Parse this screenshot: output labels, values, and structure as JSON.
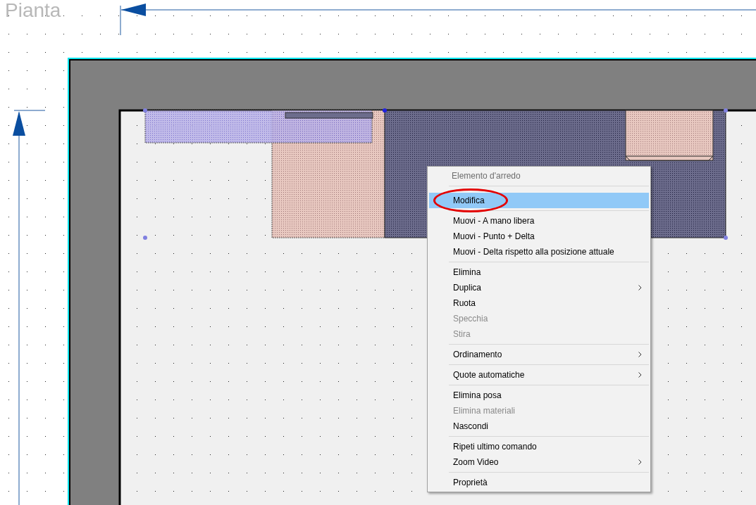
{
  "view": {
    "title": "Pianta"
  },
  "context_menu": {
    "header": "Elemento d'arredo",
    "groups": [
      [
        {
          "label": "Modifica",
          "selected": true,
          "disabled": false,
          "submenu": false,
          "circled": true
        }
      ],
      [
        {
          "label": "Muovi - A mano libera",
          "selected": false,
          "disabled": false,
          "submenu": false,
          "circled": false
        },
        {
          "label": "Muovi - Punto + Delta",
          "selected": false,
          "disabled": false,
          "submenu": false,
          "circled": false
        },
        {
          "label": "Muovi - Delta rispetto alla posizione attuale",
          "selected": false,
          "disabled": false,
          "submenu": false,
          "circled": false
        }
      ],
      [
        {
          "label": "Elimina",
          "selected": false,
          "disabled": false,
          "submenu": false,
          "circled": false
        },
        {
          "label": "Duplica",
          "selected": false,
          "disabled": false,
          "submenu": true,
          "circled": false
        },
        {
          "label": "Ruota",
          "selected": false,
          "disabled": false,
          "submenu": false,
          "circled": false
        },
        {
          "label": "Specchia",
          "selected": false,
          "disabled": true,
          "submenu": false,
          "circled": false
        },
        {
          "label": "Stira",
          "selected": false,
          "disabled": true,
          "submenu": false,
          "circled": false
        }
      ],
      [
        {
          "label": "Ordinamento",
          "selected": false,
          "disabled": false,
          "submenu": true,
          "circled": false
        }
      ],
      [
        {
          "label": "Quote automatiche",
          "selected": false,
          "disabled": false,
          "submenu": true,
          "circled": false
        }
      ],
      [
        {
          "label": "Elimina posa",
          "selected": false,
          "disabled": false,
          "submenu": false,
          "circled": false
        },
        {
          "label": "Elimina materiali",
          "selected": false,
          "disabled": true,
          "submenu": false,
          "circled": false
        },
        {
          "label": "Nascondi",
          "selected": false,
          "disabled": false,
          "submenu": false,
          "circled": false
        }
      ],
      [
        {
          "label": "Ripeti ultimo comando",
          "selected": false,
          "disabled": false,
          "submenu": false,
          "circled": false
        },
        {
          "label": "Zoom Video",
          "selected": false,
          "disabled": false,
          "submenu": true,
          "circled": false
        }
      ],
      [
        {
          "label": "Proprietà",
          "selected": false,
          "disabled": false,
          "submenu": false,
          "circled": false
        }
      ]
    ]
  }
}
